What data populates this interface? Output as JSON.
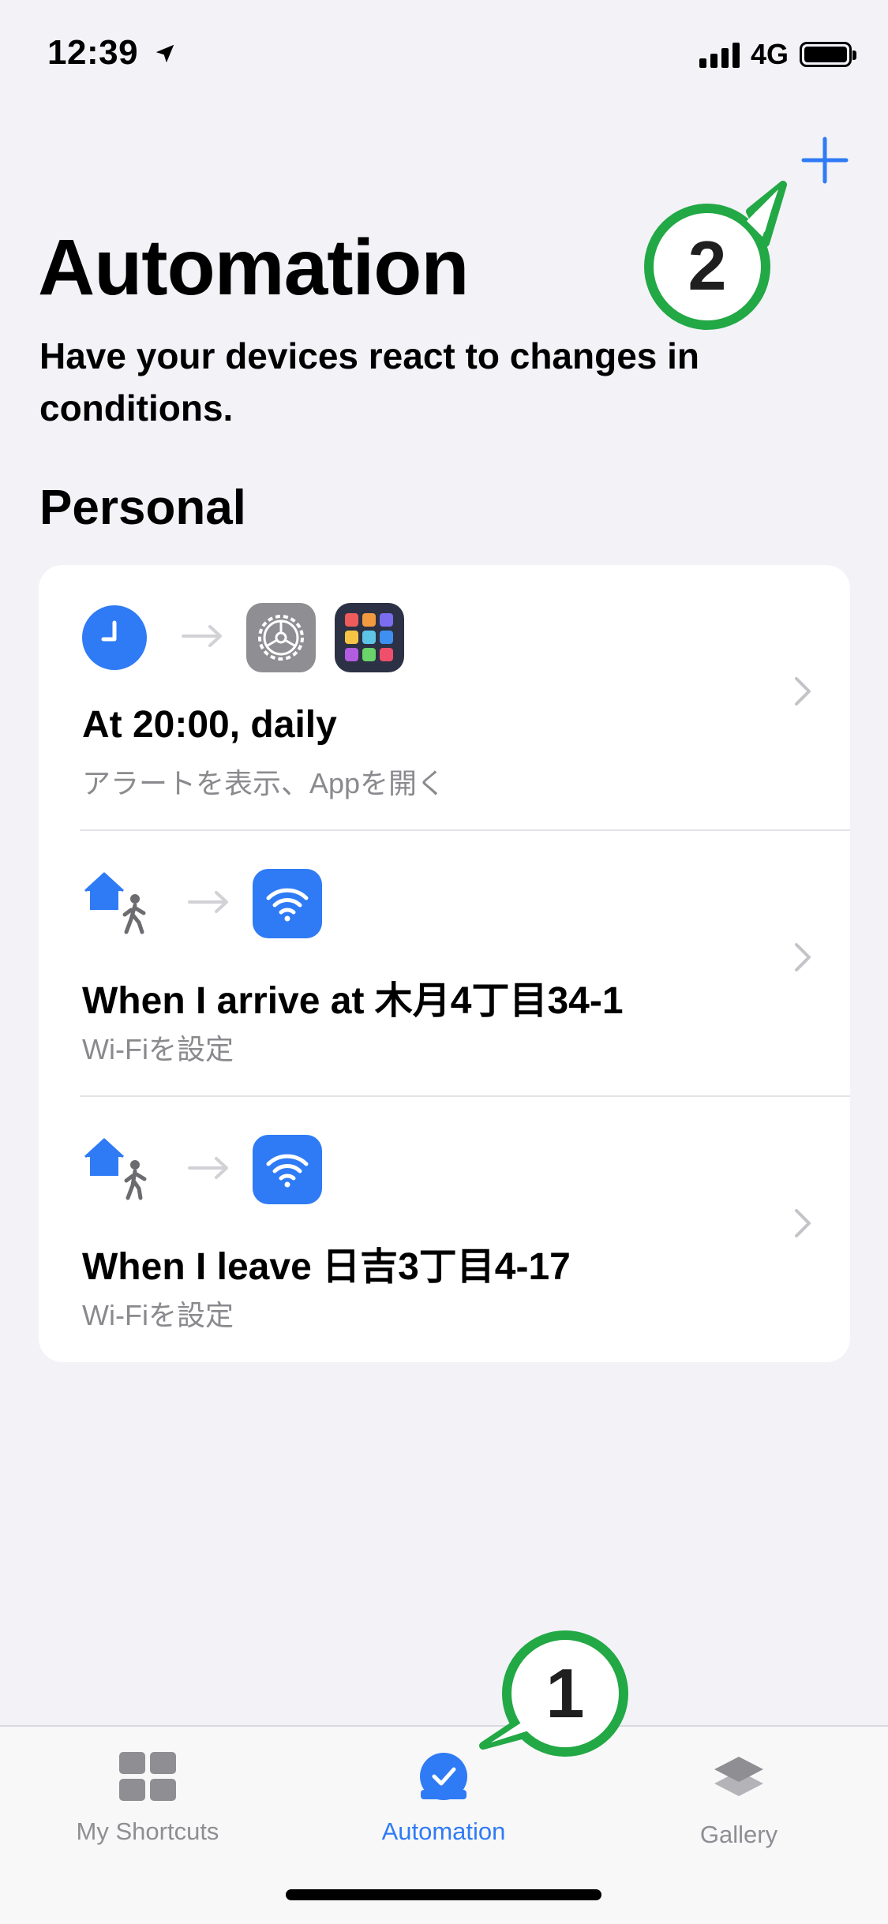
{
  "status_bar": {
    "time": "12:39",
    "network": "4G",
    "location_icon": "location-arrow-icon"
  },
  "header": {
    "add_icon": "plus-icon",
    "title": "Automation",
    "subtitle": "Have your devices react to changes in conditions."
  },
  "section": {
    "title": "Personal"
  },
  "automations": [
    {
      "title": "At 20:00, daily",
      "subtitle": "アラートを表示、Appを開く",
      "trigger_icon": "clock-icon",
      "action_icons": [
        "settings-icon",
        "app-launcher-icon"
      ]
    },
    {
      "title": "When I arrive at 木月4丁目34-1",
      "subtitle": "Wi-Fiを設定",
      "trigger_icon": "home-arrive-icon",
      "action_icons": [
        "wifi-icon"
      ]
    },
    {
      "title": "When I leave 日吉3丁目4-17",
      "subtitle": "Wi-Fiを設定",
      "trigger_icon": "home-leave-icon",
      "action_icons": [
        "wifi-icon"
      ]
    }
  ],
  "tabbar": {
    "tabs": [
      {
        "label": "My Shortcuts",
        "icon": "grid-icon",
        "active": false
      },
      {
        "label": "Automation",
        "icon": "checkmark-circle-icon",
        "active": true
      },
      {
        "label": "Gallery",
        "icon": "layers-icon",
        "active": false
      }
    ]
  },
  "annotations": {
    "callout_1": "1",
    "callout_2": "2"
  },
  "colors": {
    "accent": "#2f7bf5",
    "callout_green": "#22a845",
    "background": "#f2f2f7"
  }
}
